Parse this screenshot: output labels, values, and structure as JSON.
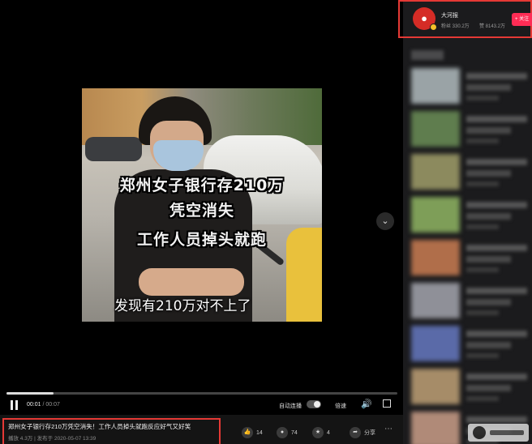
{
  "video": {
    "caption_line1": "郑州女子银行存210万",
    "caption_line2": "凭空消失",
    "caption_line3": "工作人员掉头就跑",
    "subtitle": "发现有210万对不上了"
  },
  "player": {
    "current_time": "00:01",
    "duration": "/ 00:07",
    "progress": 0.12,
    "autoplay_label": "自动连播",
    "speed_label": "倍速"
  },
  "info": {
    "title": "郑州女子银行存210万凭空消失！工作人员掉头就跑反应好气又好笑",
    "meta": "播放 4.3万 | 发布于 2020-05-07 13:39",
    "like_count": "14",
    "comment_count": "74",
    "star_count": "4",
    "share_label": "分享"
  },
  "author": {
    "name": "大河报",
    "fans": "粉丝 330.2万",
    "likes": "赞 8143.2万",
    "follow_label": "+ 关注"
  },
  "recommendations": {
    "thumb_colors": [
      "#9aa3a6",
      "#5f7d4e",
      "#8c8a5e",
      "#7e9e58",
      "#b06e4a",
      "#8f9098",
      "#5a6aa8",
      "#a68c68",
      "#b08a78"
    ]
  }
}
